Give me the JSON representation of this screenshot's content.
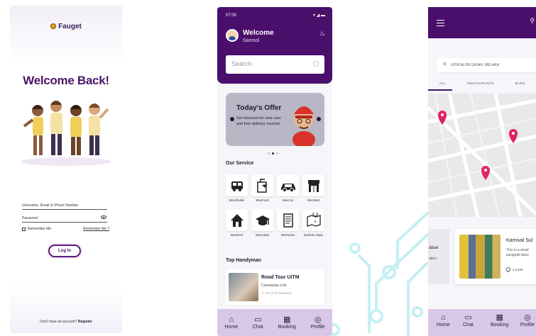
{
  "login": {
    "brand": "Fauget",
    "title": "Welcome Back!",
    "username_label": "Username, Email or Phone Number",
    "password_label": "Password",
    "remember_label": "Remember Me",
    "remember_link": "Remember Me ?",
    "login_button": "Log In",
    "no_account": "Don't have an account?",
    "register": "Register"
  },
  "home": {
    "status_time": "07:00",
    "status_icons": "▾ ◢ ▬",
    "welcome": "Welcome",
    "username": "Samsol",
    "search_placeholder": "Search",
    "offer": {
      "title": "Today's Offer",
      "text": "Get discount for new user and free delivery voucher"
    },
    "services_title": "Our Service",
    "services": [
      {
        "label": "WeeShuttle",
        "icon": "bus-icon"
      },
      {
        "label": "WeeFood",
        "icon": "food-icon"
      },
      {
        "label": "WeeCar",
        "icon": "car-icon"
      },
      {
        "label": "WeeMart",
        "icon": "store-icon"
      },
      {
        "label": "WeeRent",
        "icon": "house-icon"
      },
      {
        "label": "WeeClass",
        "icon": "graduation-cap-icon"
      },
      {
        "label": "WeeNews",
        "icon": "newspaper-icon"
      },
      {
        "label": "bambim maps",
        "icon": "map-icon"
      }
    ],
    "top_handyman_title": "Top Handyman",
    "handyman": {
      "title": "Road Tour UiTM",
      "subtitle": "Courseway Link",
      "rating": "4.8 (3.7k Reviews)"
    },
    "tabs": [
      {
        "label": "Home",
        "icon": "home-icon"
      },
      {
        "label": "Chat",
        "icon": "chat-icon"
      },
      {
        "label": "Booking",
        "icon": "calendar-icon"
      },
      {
        "label": "Profile",
        "icon": "profile-icon"
      }
    ]
  },
  "map": {
    "location": "UITM ALOR GAJAH, MELAKA",
    "tabs": [
      "ALL",
      "RESTAURANTS",
      "BARS"
    ],
    "left_card_line1": "abue",
    "left_card_line2": "ation.",
    "venue": {
      "title": "Karnival Sul",
      "desc_line1": "This is a small",
      "desc_line2": "paragrah desc",
      "distance": "2.3 KM"
    },
    "tabs_bottom": [
      {
        "label": "Home",
        "icon": "home-icon"
      },
      {
        "label": "Chat",
        "icon": "chat-icon"
      },
      {
        "label": "Booking",
        "icon": "calendar-icon"
      },
      {
        "label": "Profile",
        "icon": "profile-icon"
      }
    ]
  },
  "colors": {
    "brand_purple": "#4a0e6b",
    "tabbar": "#d8c7e6",
    "pin": "#e0245e",
    "circuit": "#9ee3ea"
  }
}
